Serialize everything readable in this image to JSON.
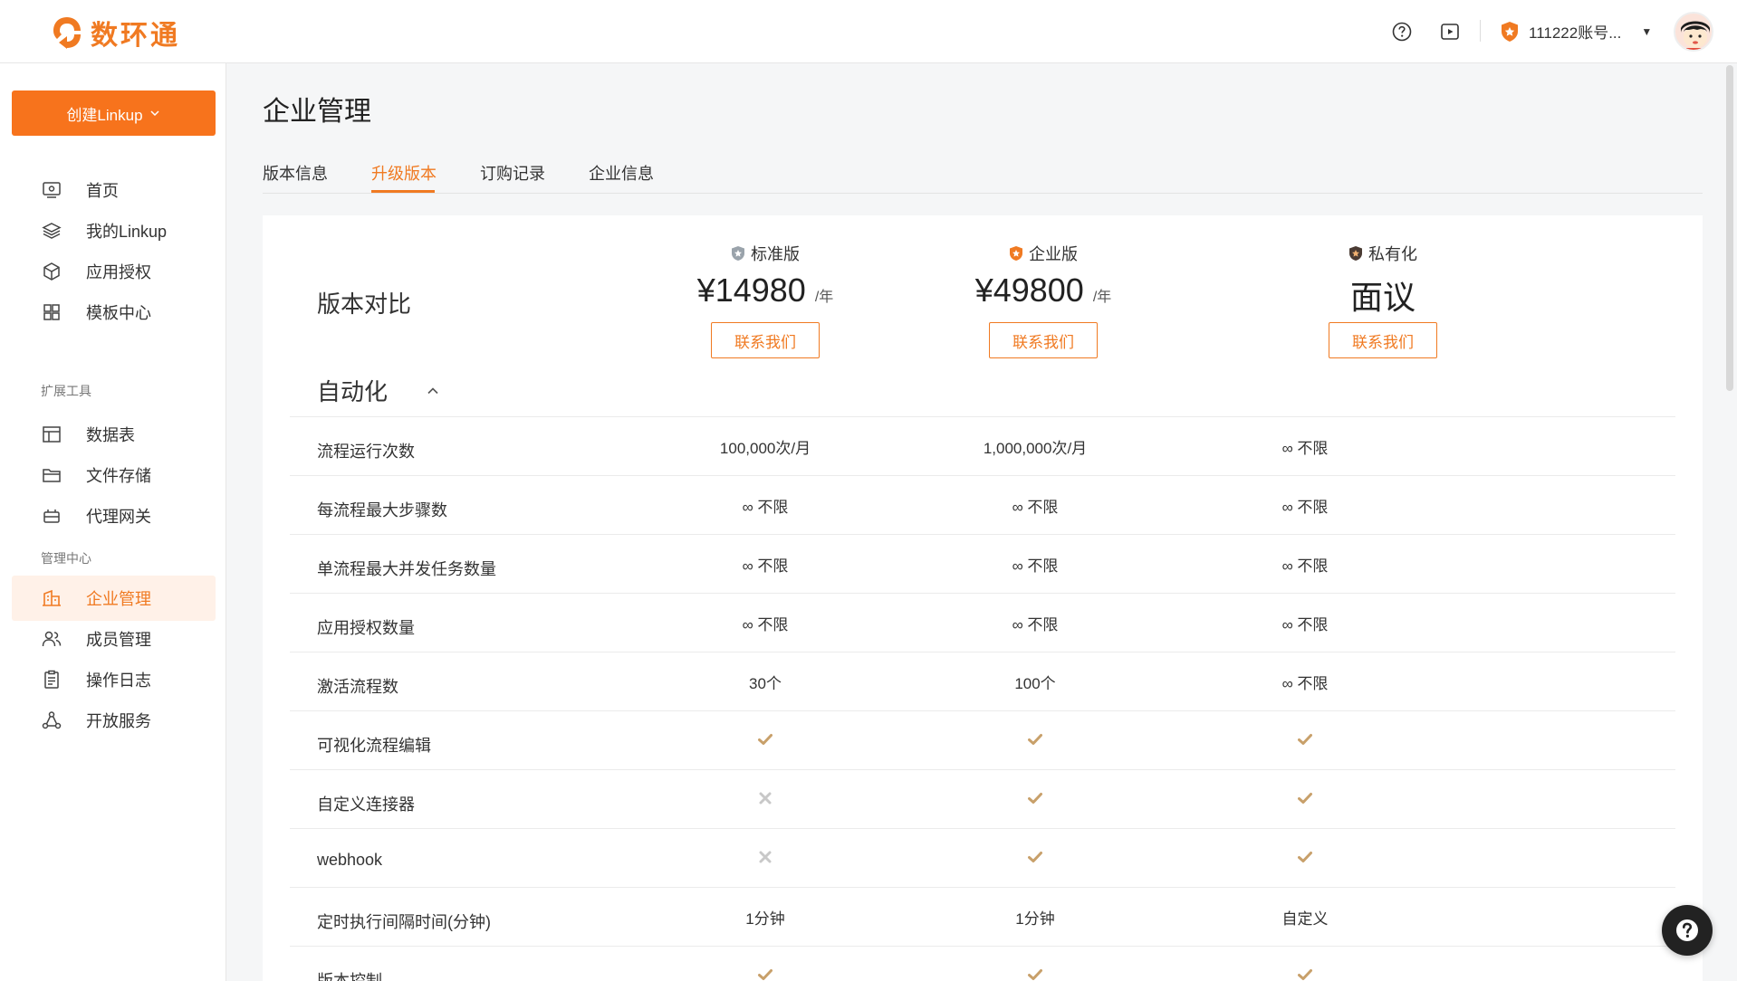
{
  "header": {
    "brand": "数环通",
    "account_name": "111222账号..."
  },
  "sidebar": {
    "create_button": "创建Linkup",
    "items_main": [
      {
        "label": "首页",
        "icon": "monitor-icon"
      },
      {
        "label": "我的Linkup",
        "icon": "layers-icon"
      },
      {
        "label": "应用授权",
        "icon": "cube-icon"
      },
      {
        "label": "模板中心",
        "icon": "grid-icon"
      }
    ],
    "section_tools": "扩展工具",
    "items_tools": [
      {
        "label": "数据表",
        "icon": "table-icon"
      },
      {
        "label": "文件存储",
        "icon": "folder-icon"
      },
      {
        "label": "代理网关",
        "icon": "gateway-icon"
      }
    ],
    "section_admin": "管理中心",
    "items_admin": [
      {
        "label": "企业管理",
        "icon": "building-icon",
        "active": true
      },
      {
        "label": "成员管理",
        "icon": "users-icon"
      },
      {
        "label": "操作日志",
        "icon": "clipboard-icon"
      },
      {
        "label": "开放服务",
        "icon": "share-network-icon"
      }
    ]
  },
  "page": {
    "title": "企业管理",
    "tabs": [
      "版本信息",
      "升级版本",
      "订购记录",
      "企业信息"
    ],
    "active_tab": "升级版本"
  },
  "comparison": {
    "label": "版本对比",
    "plans": [
      {
        "name": "标准版",
        "price": "¥14980",
        "unit": "/年",
        "button": "联系我们",
        "badge_color": "#9aa3ab"
      },
      {
        "name": "企业版",
        "price": "¥49800",
        "unit": "/年",
        "button": "联系我们",
        "badge_color": "#f07a22"
      },
      {
        "name": "私有化",
        "price": "面议",
        "unit": "",
        "button": "联系我们",
        "badge_color": "#4a3b33"
      }
    ],
    "section": "自动化",
    "rows": [
      {
        "feature": "流程运行次数",
        "values": [
          "100,000次/月",
          "1,000,000次/月",
          "∞ 不限"
        ]
      },
      {
        "feature": "每流程最大步骤数",
        "values": [
          "∞ 不限",
          "∞ 不限",
          "∞ 不限"
        ]
      },
      {
        "feature": "单流程最大并发任务数量",
        "values": [
          "∞ 不限",
          "∞ 不限",
          "∞ 不限"
        ]
      },
      {
        "feature": "应用授权数量",
        "values": [
          "∞ 不限",
          "∞ 不限",
          "∞ 不限"
        ]
      },
      {
        "feature": "激活流程数",
        "values": [
          "30个",
          "100个",
          "∞ 不限"
        ]
      },
      {
        "feature": "可视化流程编辑",
        "values": [
          "check",
          "check",
          "check"
        ]
      },
      {
        "feature": "自定义连接器",
        "values": [
          "cross",
          "check",
          "check"
        ]
      },
      {
        "feature": "webhook",
        "values": [
          "cross",
          "check",
          "check"
        ]
      },
      {
        "feature": "定时执行间隔时间(分钟)",
        "values": [
          "1分钟",
          "1分钟",
          "自定义"
        ]
      },
      {
        "feature": "版本控制",
        "values": [
          "check",
          "check",
          "check"
        ]
      }
    ]
  },
  "colors": {
    "accent": "#f07a22",
    "check": "#c8a06a",
    "cross": "#c8c8c8"
  }
}
